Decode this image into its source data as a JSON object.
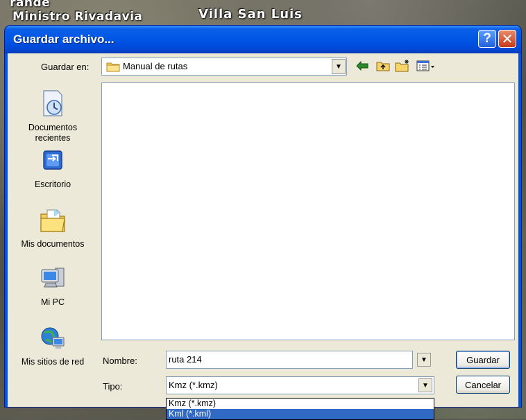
{
  "map": {
    "labels": [
      "rande",
      "Ministro Rivadavia",
      "Villa San Luis"
    ]
  },
  "dialog": {
    "title": "Guardar archivo...",
    "help_symbol": "?",
    "close_symbol": "✕"
  },
  "save_in": {
    "label": "Guardar en:",
    "value": "Manual de rutas"
  },
  "places": [
    {
      "label_line1": "Documentos",
      "label_line2": "recientes",
      "icon": "recent-documents-icon"
    },
    {
      "label_line1": "Escritorio",
      "label_line2": "",
      "icon": "desktop-icon"
    },
    {
      "label_line1": "Mis documentos",
      "label_line2": "",
      "icon": "my-documents-icon"
    },
    {
      "label_line1": "Mi PC",
      "label_line2": "",
      "icon": "my-computer-icon"
    },
    {
      "label_line1": "Mis sitios de red",
      "label_line2": "",
      "icon": "network-places-icon"
    }
  ],
  "filename": {
    "label": "Nombre:",
    "value": "ruta 214"
  },
  "filetype": {
    "label": "Tipo:",
    "value": "Kmz (*.kmz)",
    "options": [
      "Kmz (*.kmz)",
      "Kml (*.kml)"
    ]
  },
  "buttons": {
    "save": "Guardar",
    "cancel": "Cancelar"
  },
  "colors": {
    "titlebar": "#0055e5",
    "selection": "#316ac5",
    "face": "#ece9d8"
  }
}
